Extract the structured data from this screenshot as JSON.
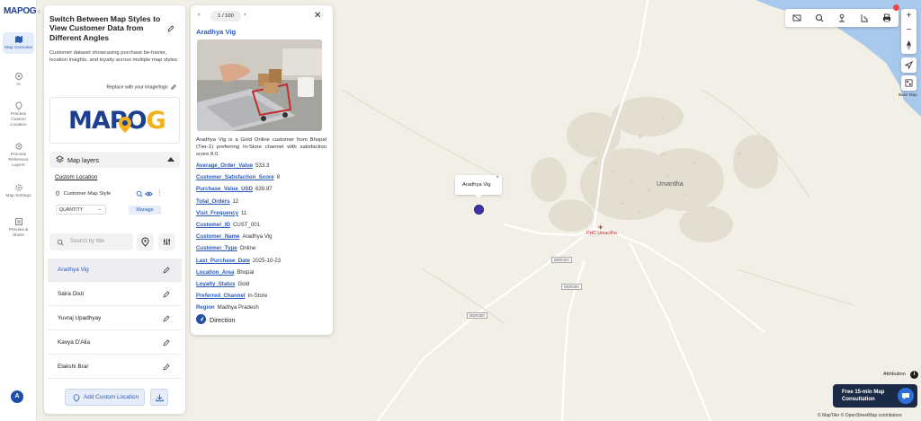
{
  "app": {
    "logo_text": "MAPOG"
  },
  "rail": {
    "items": [
      {
        "label": "Map Overview",
        "icon": "map-icon"
      },
      {
        "label": "AI",
        "icon": "ai-icon"
      },
      {
        "label": "Process Custom Location",
        "icon": "location-pin-icon"
      },
      {
        "label": "Process Reference Layers",
        "icon": "layers-gear-icon"
      },
      {
        "label": "Map Settings",
        "icon": "settings-icon"
      },
      {
        "label": "Preview & Share",
        "icon": "preview-icon"
      }
    ],
    "avatar": "A"
  },
  "panel": {
    "title": "Switch Between Map Styles to View Customer Data from Different Angles",
    "description": "Customer dataset showcasing purchase be-havior, location insights, and loyalty across multiple map styles.",
    "replace_label": "Replace with your image/logo",
    "layers_label": "Map layers",
    "custom_location_label": "Custom Location",
    "layer_name": "Customer Map Style",
    "style_select": "QUANTITY",
    "manage_label": "Manage",
    "search_placeholder": "Search by title",
    "list": [
      "Aradhya Vig",
      "Saira Dixit",
      "Yuvraj Upadhyay",
      "Kavya D'Alia",
      "Elakshi Brar"
    ],
    "add_button": "Add Custom Location"
  },
  "card": {
    "pager": "1 / 100",
    "name": "Aradhya Vig",
    "description": "Aradhya Vig is a Gold Online customer from Bhopal (Tier-1) preferring In-Store channel with satisfaction score 8.0.",
    "attributes": [
      {
        "key": "Average_Order_Value",
        "value": "533.3"
      },
      {
        "key": "Customer_Satisfaction_Score",
        "value": "8"
      },
      {
        "key": "Purchase_Value_USD",
        "value": "639.97"
      },
      {
        "key": "Total_Orders",
        "value": "12"
      },
      {
        "key": "Visit_Frequency",
        "value": "11"
      },
      {
        "key": "Customer_ID",
        "value": "CUST_001"
      },
      {
        "key": "Customer_Name",
        "value": "Aradhya Vig"
      },
      {
        "key": "Customer_Type",
        "value": "Online"
      },
      {
        "key": "Last_Purchase_Date",
        "value": "2025-10-23"
      },
      {
        "key": "Location_Area",
        "value": "Bhopal"
      },
      {
        "key": "Loyalty_Status",
        "value": "Gold"
      },
      {
        "key": "Preferred_Channel",
        "value": "In-Store"
      },
      {
        "key": "Region",
        "value": "Madhya Pradesh"
      }
    ],
    "direction_label": "Direction"
  },
  "map": {
    "tooltip": "Aradhya Vig",
    "place_label": "Umardha",
    "phc_label": "PHC Umardha",
    "road_labels": [
      "MDR300",
      "MDR300",
      "MDR300"
    ],
    "base_map_label": "Base Map",
    "attribution_label": "Attribution",
    "consult_line1": "Free 15-min Map",
    "consult_line2": "Consultation",
    "credits": "© MapTiler © OpenStreetMap contributors",
    "colors": {
      "water": "#9fc4ee",
      "marker": "#3f33a8",
      "accent": "#2d5bb9"
    }
  }
}
